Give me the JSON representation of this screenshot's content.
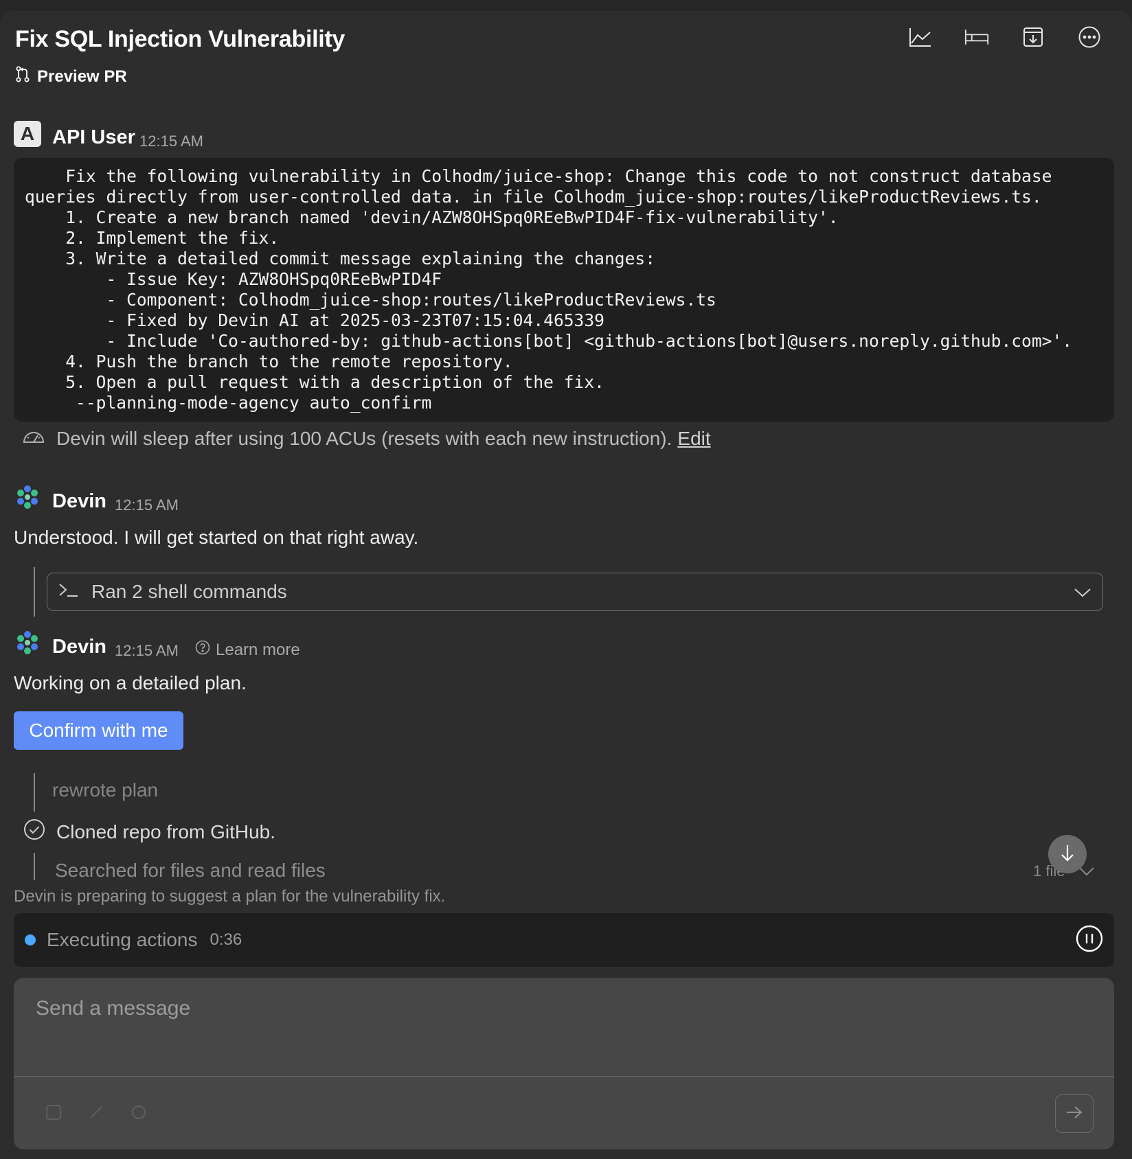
{
  "header": {
    "title": "Fix SQL Injection Vulnerability",
    "preview_pr": "Preview PR",
    "icons": [
      "chart-icon",
      "bed-icon",
      "download-box-icon",
      "more-icon"
    ]
  },
  "messages": {
    "user": {
      "avatar_letter": "A",
      "author": "API User",
      "time": "12:15 AM",
      "code": "    Fix the following vulnerability in Colhodm/juice-shop: Change this code to not construct database\nqueries directly from user-controlled data. in file Colhodm_juice-shop:routes/likeProductReviews.ts.\n    1. Create a new branch named 'devin/AZW8OHSpq0REeBwPID4F-fix-vulnerability'.\n    2. Implement the fix.\n    3. Write a detailed commit message explaining the changes:\n        - Issue Key: AZW8OHSpq0REeBwPID4F\n        - Component: Colhodm_juice-shop:routes/likeProductReviews.ts\n        - Fixed by Devin AI at 2025-03-23T07:15:04.465339\n        - Include 'Co-authored-by: github-actions[bot] <github-actions[bot]@users.noreply.github.com>'.\n    4. Push the branch to the remote repository.\n    5. Open a pull request with a description of the fix.\n     --planning-mode-agency auto_confirm"
    },
    "sleep_notice": {
      "text": "Devin will sleep after using 100 ACUs (resets with each new instruction).",
      "edit_link": "Edit"
    },
    "devin1": {
      "author": "Devin",
      "time": "12:15 AM",
      "text": "Understood. I will get started on that right away.",
      "shell_summary": "Ran 2 shell commands"
    },
    "devin2": {
      "author": "Devin",
      "time": "12:15 AM",
      "learn_more": "Learn more",
      "text": "Working on a detailed plan.",
      "confirm_button": "Confirm with me"
    }
  },
  "activity": {
    "rewrote": "rewrote plan",
    "cloned": "Cloned repo from GitHub.",
    "searched": "Searched for files and read files",
    "file_count": "1 file",
    "preparing": "Devin is preparing to suggest a plan for the vulnerability fix."
  },
  "status": {
    "label": "Executing actions",
    "elapsed": "0:36",
    "dot_color": "#4aa8ff"
  },
  "composer": {
    "placeholder": "Send a message"
  },
  "colors": {
    "accent": "#5f8cf7",
    "background": "#2d2d2d"
  }
}
